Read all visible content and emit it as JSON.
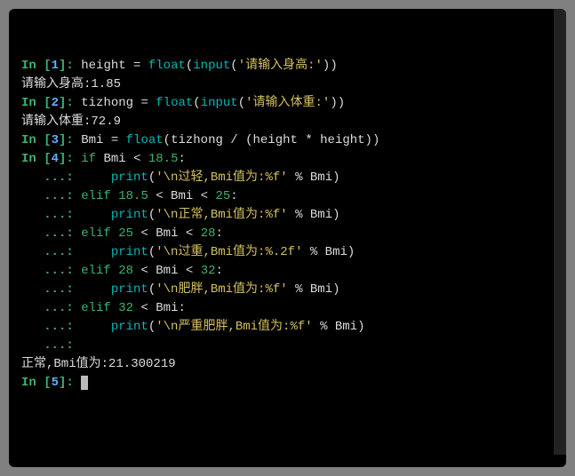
{
  "cells": [
    {
      "n": "1",
      "prompt_pre": "In [",
      "prompt_post": "]: ",
      "code_tokens": [
        {
          "t": "height ",
          "c": "wh"
        },
        {
          "t": "=",
          "c": "wh"
        },
        {
          "t": " ",
          "c": "wh"
        },
        {
          "t": "float",
          "c": "cy"
        },
        {
          "t": "(",
          "c": "wh"
        },
        {
          "t": "input",
          "c": "cy"
        },
        {
          "t": "(",
          "c": "wh"
        },
        {
          "t": "'请输入身高:'",
          "c": "ye"
        },
        {
          "t": "))",
          "c": "wh"
        }
      ],
      "output": "请输入身高:1.85"
    },
    {
      "n": "2",
      "prompt_pre": "In [",
      "prompt_post": "]: ",
      "code_tokens": [
        {
          "t": "tizhong ",
          "c": "wh"
        },
        {
          "t": "=",
          "c": "wh"
        },
        {
          "t": " ",
          "c": "wh"
        },
        {
          "t": "float",
          "c": "cy"
        },
        {
          "t": "(",
          "c": "wh"
        },
        {
          "t": "input",
          "c": "cy"
        },
        {
          "t": "(",
          "c": "wh"
        },
        {
          "t": "'请输入体重:'",
          "c": "ye"
        },
        {
          "t": "))",
          "c": "wh"
        }
      ],
      "output": "请输入体重:72.9"
    },
    {
      "n": "3",
      "prompt_pre": "In [",
      "prompt_post": "]: ",
      "code_tokens": [
        {
          "t": "Bmi ",
          "c": "wh"
        },
        {
          "t": "=",
          "c": "wh"
        },
        {
          "t": " ",
          "c": "wh"
        },
        {
          "t": "float",
          "c": "cy"
        },
        {
          "t": "(tizhong ",
          "c": "wh"
        },
        {
          "t": "/",
          "c": "wh"
        },
        {
          "t": " (height ",
          "c": "wh"
        },
        {
          "t": "*",
          "c": "wh"
        },
        {
          "t": " height))",
          "c": "wh"
        }
      ],
      "output": ""
    }
  ],
  "cell4": {
    "n": "4",
    "prompt_pre": "In [",
    "prompt_post": "]: ",
    "cont": "   ...: ",
    "lines": [
      [
        {
          "t": "if",
          "c": "gr"
        },
        {
          "t": " Bmi ",
          "c": "wh"
        },
        {
          "t": "<",
          "c": "wh"
        },
        {
          "t": " ",
          "c": "wh"
        },
        {
          "t": "18.5",
          "c": "gr"
        },
        {
          "t": ":",
          "c": "wh"
        }
      ],
      [
        {
          "t": "    ",
          "c": "wh"
        },
        {
          "t": "print",
          "c": "cy"
        },
        {
          "t": "(",
          "c": "wh"
        },
        {
          "t": "'\\n过轻,Bmi值为:%f'",
          "c": "ye"
        },
        {
          "t": " % Bmi)",
          "c": "wh"
        }
      ],
      [
        {
          "t": "elif",
          "c": "gr"
        },
        {
          "t": " ",
          "c": "wh"
        },
        {
          "t": "18.5",
          "c": "gr"
        },
        {
          "t": " ",
          "c": "wh"
        },
        {
          "t": "<",
          "c": "wh"
        },
        {
          "t": " Bmi ",
          "c": "wh"
        },
        {
          "t": "<",
          "c": "wh"
        },
        {
          "t": " ",
          "c": "wh"
        },
        {
          "t": "25",
          "c": "gr"
        },
        {
          "t": ":",
          "c": "wh"
        }
      ],
      [
        {
          "t": "    ",
          "c": "wh"
        },
        {
          "t": "print",
          "c": "cy"
        },
        {
          "t": "(",
          "c": "wh"
        },
        {
          "t": "'\\n正常,Bmi值为:%f'",
          "c": "ye"
        },
        {
          "t": " % Bmi)",
          "c": "wh"
        }
      ],
      [
        {
          "t": "elif",
          "c": "gr"
        },
        {
          "t": " ",
          "c": "wh"
        },
        {
          "t": "25",
          "c": "gr"
        },
        {
          "t": " ",
          "c": "wh"
        },
        {
          "t": "<",
          "c": "wh"
        },
        {
          "t": " Bmi ",
          "c": "wh"
        },
        {
          "t": "<",
          "c": "wh"
        },
        {
          "t": " ",
          "c": "wh"
        },
        {
          "t": "28",
          "c": "gr"
        },
        {
          "t": ":",
          "c": "wh"
        }
      ],
      [
        {
          "t": "    ",
          "c": "wh"
        },
        {
          "t": "print",
          "c": "cy"
        },
        {
          "t": "(",
          "c": "wh"
        },
        {
          "t": "'\\n过重,Bmi值为:%.2f'",
          "c": "ye"
        },
        {
          "t": " % Bmi)",
          "c": "wh"
        }
      ],
      [
        {
          "t": "elif",
          "c": "gr"
        },
        {
          "t": " ",
          "c": "wh"
        },
        {
          "t": "28",
          "c": "gr"
        },
        {
          "t": " ",
          "c": "wh"
        },
        {
          "t": "<",
          "c": "wh"
        },
        {
          "t": " Bmi ",
          "c": "wh"
        },
        {
          "t": "<",
          "c": "wh"
        },
        {
          "t": " ",
          "c": "wh"
        },
        {
          "t": "32",
          "c": "gr"
        },
        {
          "t": ":",
          "c": "wh"
        }
      ],
      [
        {
          "t": "    ",
          "c": "wh"
        },
        {
          "t": "print",
          "c": "cy"
        },
        {
          "t": "(",
          "c": "wh"
        },
        {
          "t": "'\\n肥胖,Bmi值为:%f'",
          "c": "ye"
        },
        {
          "t": " % Bmi)",
          "c": "wh"
        }
      ],
      [
        {
          "t": "elif",
          "c": "gr"
        },
        {
          "t": " ",
          "c": "wh"
        },
        {
          "t": "32",
          "c": "gr"
        },
        {
          "t": " ",
          "c": "wh"
        },
        {
          "t": "<",
          "c": "wh"
        },
        {
          "t": " Bmi:",
          "c": "wh"
        }
      ],
      [
        {
          "t": "    ",
          "c": "wh"
        },
        {
          "t": "print",
          "c": "cy"
        },
        {
          "t": "(",
          "c": "wh"
        },
        {
          "t": "'\\n严重肥胖,Bmi值为:%f'",
          "c": "ye"
        },
        {
          "t": " % Bmi)",
          "c": "wh"
        }
      ],
      [
        {
          "t": "",
          "c": "wh"
        }
      ]
    ],
    "output": "正常,Bmi值为:21.300219"
  },
  "cell5": {
    "n": "5",
    "prompt_pre": "In [",
    "prompt_post": "]: "
  }
}
